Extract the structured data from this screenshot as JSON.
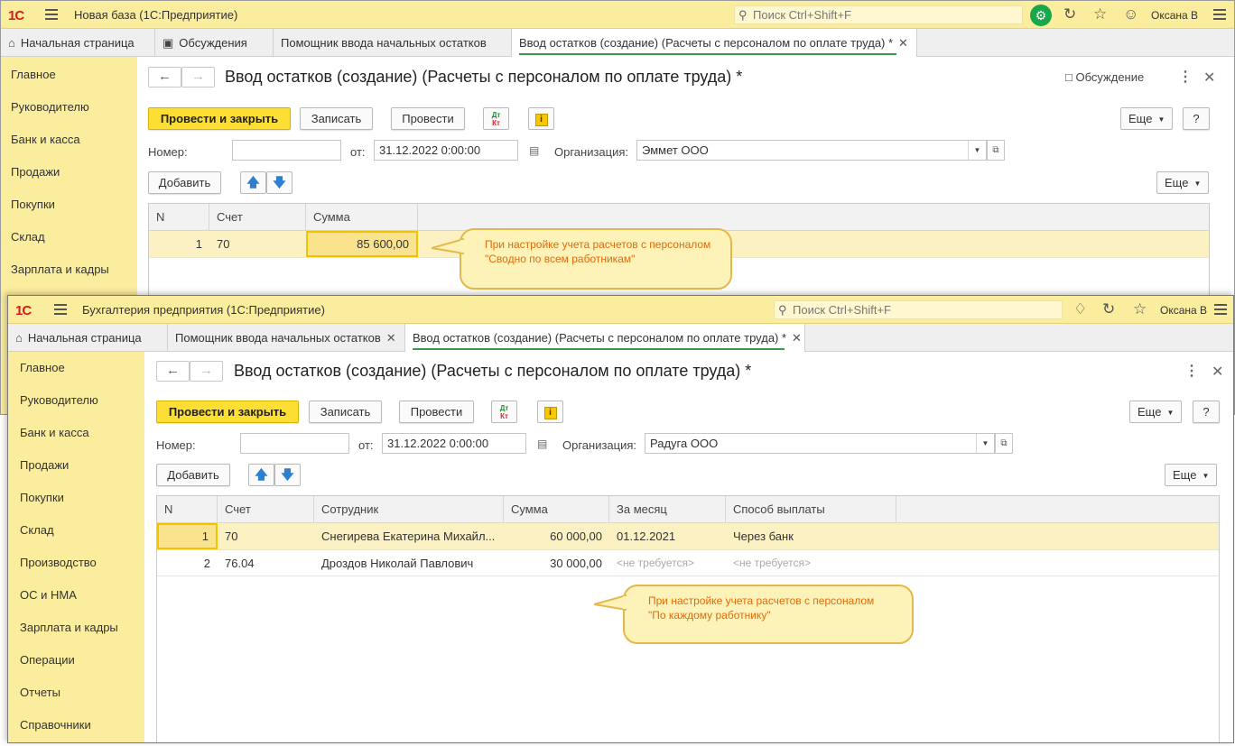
{
  "w1": {
    "logo": "1С",
    "app_title": "Новая база  (1С:Предприятие)",
    "search_placeholder": "Поиск Ctrl+Shift+F",
    "user": "Оксана В",
    "tabs": [
      {
        "label": "Начальная страница"
      },
      {
        "label": "Обсуждения"
      },
      {
        "label": "Помощник ввода начальных остатков"
      },
      {
        "label": "Ввод остатков (создание) (Расчеты с персоналом по оплате труда) *"
      }
    ],
    "sidebar": [
      "Главное",
      "Руководителю",
      "Банк и касса",
      "Продажи",
      "Покупки",
      "Склад",
      "Зарплата и кадры"
    ],
    "form_title": "Ввод остатков (создание) (Расчеты с персоналом по оплате труда) *",
    "discussion": "Обсуждение",
    "buttons": {
      "post_close": "Провести и закрыть",
      "save": "Записать",
      "post": "Провести",
      "more": "Еще",
      "help": "?",
      "add": "Добавить",
      "more2": "Еще"
    },
    "dtkt": {
      "d": "Дт",
      "k": "Кт"
    },
    "number_label": "Номер:",
    "number_value": "",
    "from_label": "от:",
    "date_value": "31.12.2022  0:00:00",
    "org_label": "Организация:",
    "org_value": "Эммет ООО",
    "columns": [
      "N",
      "Счет",
      "Сумма"
    ],
    "rows": [
      {
        "n": "1",
        "account": "70",
        "sum": "85 600,00"
      }
    ],
    "callout": [
      "При настройке учета расчетов с персоналом",
      "\"Сводно по всем работникам\""
    ]
  },
  "w2": {
    "logo": "1С",
    "app_title": "Бухгалтерия предприятия  (1С:Предприятие)",
    "search_placeholder": "Поиск Ctrl+Shift+F",
    "user": "Оксана В",
    "tabs": [
      {
        "label": "Начальная страница"
      },
      {
        "label": "Помощник ввода начальных остатков"
      },
      {
        "label": "Ввод остатков (создание) (Расчеты с персоналом по оплате труда) *"
      }
    ],
    "sidebar": [
      "Главное",
      "Руководителю",
      "Банк и касса",
      "Продажи",
      "Покупки",
      "Склад",
      "Производство",
      "ОС и НМА",
      "Зарплата и кадры",
      "Операции",
      "Отчеты",
      "Справочники"
    ],
    "form_title": "Ввод остатков (создание) (Расчеты с персоналом по оплате труда) *",
    "buttons": {
      "post_close": "Провести и закрыть",
      "save": "Записать",
      "post": "Провести",
      "more": "Еще",
      "help": "?",
      "add": "Добавить",
      "more2": "Еще"
    },
    "dtkt": {
      "d": "Дт",
      "k": "Кт"
    },
    "number_label": "Номер:",
    "number_value": "",
    "from_label": "от:",
    "date_value": "31.12.2022  0:00:00",
    "org_label": "Организация:",
    "org_value": "Радуга ООО",
    "columns": [
      "N",
      "Счет",
      "Сотрудник",
      "Сумма",
      "За месяц",
      "Способ выплаты"
    ],
    "rows": [
      {
        "n": "1",
        "account": "70",
        "employee": "Снегирева Екатерина Михайл...",
        "sum": "60 000,00",
        "month": "01.12.2021",
        "method": "Через банк"
      },
      {
        "n": "2",
        "account": "76.04",
        "employee": "Дроздов Николай Павлович",
        "sum": "30 000,00",
        "month": "<не требуется>",
        "method": "<не требуется>"
      }
    ],
    "callout": [
      "При настройке учета расчетов с персоналом",
      "\"По каждому работнику\""
    ]
  },
  "colors": {
    "sidebar": "#fbed9e",
    "primary_button": "#fdde35",
    "callout_text": "#e26b0a",
    "selected_row": "#fbf1c2",
    "tab_underline": "#3a9a4a"
  }
}
